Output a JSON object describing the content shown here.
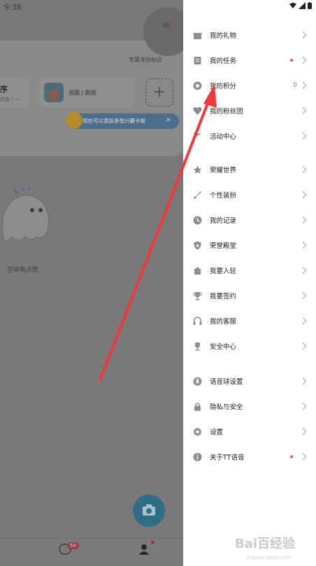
{
  "status_bar": {
    "time": "9:38"
  },
  "background_app": {
    "exclusive_label": "专属身份标识",
    "left_card_title": "序",
    "left_card_sub": "状态 | 一",
    "game_card_name": "国服 | 跑图",
    "tip_text": "现在可以添加多张兴趣卡啦",
    "empty_text": "空间有点慌",
    "chat_badge": "50"
  },
  "drawer": {
    "items": [
      {
        "label": "我的礼物",
        "icon": "gift-icon"
      },
      {
        "label": "我的任务",
        "icon": "task-icon",
        "dot": true
      },
      {
        "label": "我的积分",
        "icon": "points-icon",
        "value": "0"
      },
      {
        "label": "我的粉丝团",
        "icon": "heart-icon"
      },
      {
        "label": "活动中心",
        "icon": "flag-icon"
      },
      {
        "label": "荣耀世界",
        "icon": "star-icon"
      },
      {
        "label": "个性装扮",
        "icon": "brush-icon"
      },
      {
        "label": "我的记录",
        "icon": "clock-icon"
      },
      {
        "label": "荣誉殿堂",
        "icon": "shield-icon"
      },
      {
        "label": "我要入驻",
        "icon": "home-icon"
      },
      {
        "label": "我要签约",
        "icon": "trophy-icon"
      },
      {
        "label": "我的客服",
        "icon": "headset-icon"
      },
      {
        "label": "安全中心",
        "icon": "safety-icon"
      },
      {
        "label": "语音球设置",
        "icon": "mic-icon"
      },
      {
        "label": "隐私与安全",
        "icon": "lock-icon"
      },
      {
        "label": "设置",
        "icon": "gear-icon"
      },
      {
        "label": "关于TT语音",
        "icon": "info-icon",
        "dot": true
      }
    ]
  },
  "watermark": {
    "main": "Bai百经验",
    "sub": "jingyan.baidu.com"
  },
  "colors": {
    "annotation_arrow": "#f0393c",
    "badge_dot": "#ee4b7a",
    "icon_gray": "#8d8f94"
  }
}
